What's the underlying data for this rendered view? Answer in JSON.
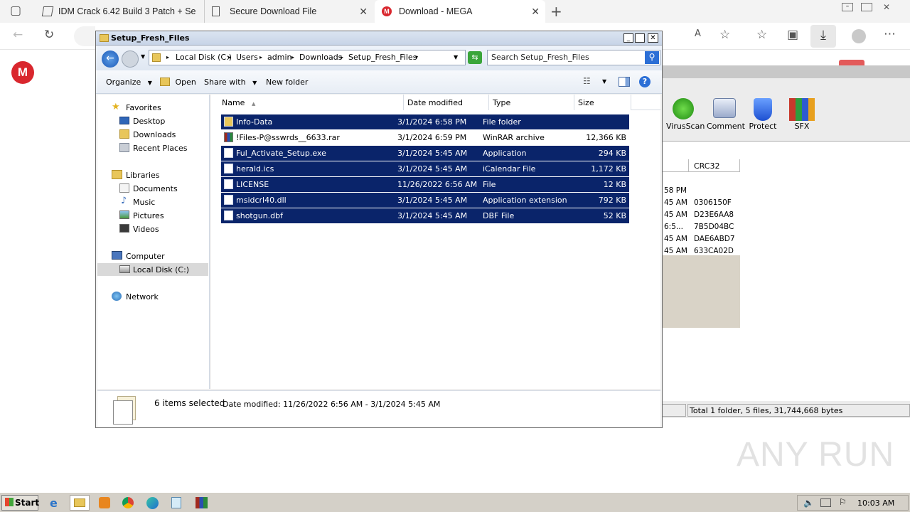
{
  "browser": {
    "tabs": [
      {
        "label": "IDM Crack 6.42 Build 3 Patch + Se"
      },
      {
        "label": "Secure Download File"
      },
      {
        "label": "Download - MEGA"
      }
    ]
  },
  "explorer": {
    "title": "Setup_Fresh_Files",
    "breadcrumb": [
      "Local Disk (C:)",
      "Users",
      "admin",
      "Downloads",
      "Setup_Fresh_Files"
    ],
    "search_placeholder": "Search Setup_Fresh_Files",
    "toolbar": {
      "organize": "Organize",
      "open": "Open",
      "share_with": "Share with",
      "new_folder": "New folder"
    },
    "nav": {
      "favorites": "Favorites",
      "desktop": "Desktop",
      "downloads": "Downloads",
      "recent": "Recent Places",
      "libraries": "Libraries",
      "documents": "Documents",
      "music": "Music",
      "pictures": "Pictures",
      "videos": "Videos",
      "computer": "Computer",
      "local_disk": "Local Disk (C:)",
      "network": "Network"
    },
    "columns": {
      "name": "Name",
      "date": "Date modified",
      "type": "Type",
      "size": "Size"
    },
    "files": [
      {
        "name": "Info-Data",
        "date": "3/1/2024 6:58 PM",
        "type": "File folder",
        "size": "",
        "selected": true,
        "icon": "folder-icon"
      },
      {
        "name": "!Files-P@sswrds__6633.rar",
        "date": "3/1/2024 6:59 PM",
        "type": "WinRAR archive",
        "size": "12,366 KB",
        "selected": false,
        "icon": "winrar-archive-icon"
      },
      {
        "name": "Ful_Activate_Setup.exe",
        "date": "3/1/2024 5:45 AM",
        "type": "Application",
        "size": "294 KB",
        "selected": true,
        "icon": "exe-icon"
      },
      {
        "name": "herald.ics",
        "date": "3/1/2024 5:45 AM",
        "type": "iCalendar File",
        "size": "1,172 KB",
        "selected": true,
        "icon": "calendar-file-icon"
      },
      {
        "name": "LICENSE",
        "date": "11/26/2022 6:56 AM",
        "type": "File",
        "size": "12 KB",
        "selected": true,
        "icon": "file-icon"
      },
      {
        "name": "msidcrl40.dll",
        "date": "3/1/2024 5:45 AM",
        "type": "Application extension",
        "size": "792 KB",
        "selected": true,
        "icon": "dll-icon"
      },
      {
        "name": "shotgun.dbf",
        "date": "3/1/2024 5:45 AM",
        "type": "DBF File",
        "size": "52 KB",
        "selected": true,
        "icon": "file-icon"
      }
    ],
    "status": {
      "selected": "6 items selected",
      "date_range": "Date modified: 11/26/2022 6:56 AM - 3/1/2024 5:45 AM"
    }
  },
  "winrar": {
    "buttons": {
      "virusscan": "VirusScan",
      "comment": "Comment",
      "protect": "Protect",
      "sfx": "SFX"
    },
    "crc_header": "CRC32",
    "rows": [
      {
        "time": "58 PM",
        "crc": ""
      },
      {
        "time": "45 AM",
        "crc": "0306150F"
      },
      {
        "time": "45 AM",
        "crc": "D23E6AA8"
      },
      {
        "time": "6:5...",
        "crc": "7B5D04BC"
      },
      {
        "time": "45 AM",
        "crc": "DAE6ABD7"
      },
      {
        "time": "45 AM",
        "crc": "633CA02D"
      }
    ],
    "status": "Total 1 folder, 5 files, 31,744,668 bytes"
  },
  "watermark": "ANY RUN",
  "taskbar": {
    "start": "Start",
    "clock": "10:03 AM"
  }
}
